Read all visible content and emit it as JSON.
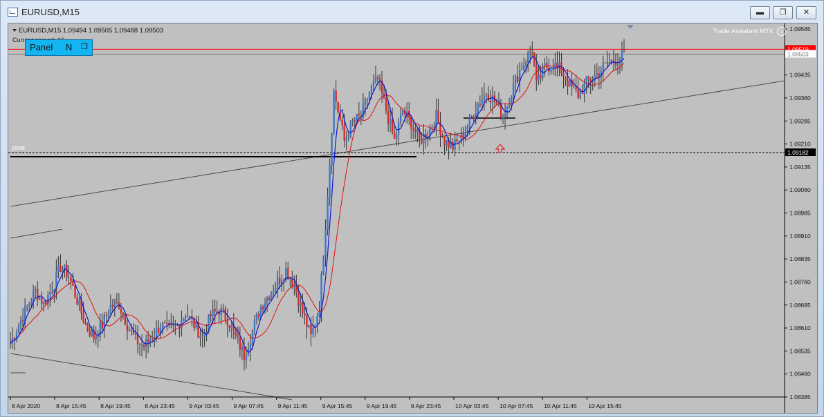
{
  "window": {
    "title": "EURUSD,M15",
    "minimize_glyph": "▬",
    "restore_glyph": "❐",
    "close_glyph": "✕"
  },
  "chart_header": {
    "info": "EURUSD,M15  1.09494 1.09505 1.09488 1.09503",
    "spread": "Current spread: 16",
    "indicator": "Trade Assistant MT4"
  },
  "panel": {
    "label": "Panel",
    "letter": "N",
    "icon": "restore-icon"
  },
  "colors": {
    "background": "#c0c0c0",
    "bull": "#3f77c4",
    "bear": "#d42b2b",
    "ma_fast": "#1414c8",
    "ma_slow": "#e01010",
    "resistance": "#ff0000",
    "arrow": "#e02020"
  },
  "chart_data": {
    "type": "candlestick",
    "symbol": "EURUSD",
    "timeframe": "M15",
    "last_ohlc": {
      "open": 1.09494,
      "high": 1.09505,
      "low": 1.09488,
      "close": 1.09503
    },
    "ylim": [
      1.08385,
      1.09585
    ],
    "y_ticks": [
      "1.09585",
      "1.09435",
      "1.09360",
      "1.09285",
      "1.09210",
      "1.09135",
      "1.09060",
      "1.08985",
      "1.08910",
      "1.08835",
      "1.08760",
      "1.08685",
      "1.08610",
      "1.08535",
      "1.08460",
      "1.08385"
    ],
    "x_ticks": [
      "8 Apr 2020",
      "8 Apr 15:45",
      "8 Apr 19:45",
      "8 Apr 23:45",
      "9 Apr 03:45",
      "9 Apr 07:45",
      "9 Apr 11:45",
      "9 Apr 15:45",
      "9 Apr 19:45",
      "9 Apr 23:45",
      "10 Apr 03:45",
      "10 Apr 07:45",
      "10 Apr 11:45",
      "10 Apr 15:45"
    ],
    "price_labels": [
      {
        "value": "1.09519",
        "kind": "resistance"
      },
      {
        "value": "1.09503",
        "kind": "current"
      },
      {
        "value": "1.09182",
        "kind": "pivot"
      }
    ],
    "pivot_label": "pivot",
    "close_path": [
      [
        0,
        1.0856
      ],
      [
        4,
        1.0862
      ],
      [
        8,
        1.0868
      ],
      [
        12,
        1.0873
      ],
      [
        16,
        1.0869
      ],
      [
        20,
        1.0874
      ],
      [
        24,
        1.0881
      ],
      [
        28,
        1.0878
      ],
      [
        32,
        1.087
      ],
      [
        36,
        1.0862
      ],
      [
        40,
        1.0858
      ],
      [
        44,
        1.0862
      ],
      [
        48,
        1.0868
      ],
      [
        52,
        1.0869
      ],
      [
        56,
        1.0862
      ],
      [
        60,
        1.0857
      ],
      [
        64,
        1.0855
      ],
      [
        68,
        1.0858
      ],
      [
        72,
        1.0862
      ],
      [
        76,
        1.086
      ],
      [
        80,
        1.0862
      ],
      [
        84,
        1.0866
      ],
      [
        88,
        1.0862
      ],
      [
        92,
        1.0858
      ],
      [
        96,
        1.0865
      ],
      [
        100,
        1.0867
      ],
      [
        104,
        1.0864
      ],
      [
        108,
        1.0858
      ],
      [
        112,
        1.0852
      ],
      [
        116,
        1.086
      ],
      [
        120,
        1.0868
      ],
      [
        124,
        1.0872
      ],
      [
        128,
        1.0876
      ],
      [
        132,
        1.088
      ],
      [
        136,
        1.0875
      ],
      [
        140,
        1.0866
      ],
      [
        144,
        1.0858
      ],
      [
        148,
        1.0868
      ],
      [
        151,
        1.0895
      ],
      [
        153,
        1.0915
      ],
      [
        155,
        1.0938
      ],
      [
        157,
        1.0932
      ],
      [
        160,
        1.0922
      ],
      [
        164,
        1.0928
      ],
      [
        168,
        1.093
      ],
      [
        172,
        1.0938
      ],
      [
        176,
        1.0942
      ],
      [
        180,
        1.0932
      ],
      [
        184,
        1.0922
      ],
      [
        188,
        1.0932
      ],
      [
        192,
        1.0928
      ],
      [
        196,
        1.0922
      ],
      [
        200,
        1.0925
      ],
      [
        204,
        1.093
      ],
      [
        208,
        1.0922
      ],
      [
        212,
        1.092
      ],
      [
        216,
        1.0923
      ],
      [
        220,
        1.0928
      ],
      [
        224,
        1.0934
      ],
      [
        228,
        1.0938
      ],
      [
        232,
        1.0935
      ],
      [
        236,
        1.093
      ],
      [
        240,
        1.0938
      ],
      [
        244,
        1.0945
      ],
      [
        248,
        1.095
      ],
      [
        250,
        1.0952
      ],
      [
        252,
        1.094
      ],
      [
        256,
        1.0946
      ],
      [
        260,
        1.0947
      ],
      [
        264,
        1.0945
      ],
      [
        268,
        1.094
      ],
      [
        272,
        1.0937
      ],
      [
        276,
        1.0941
      ],
      [
        280,
        1.0943
      ],
      [
        284,
        1.0946
      ],
      [
        288,
        1.0948
      ],
      [
        292,
        1.0949
      ],
      [
        294,
        1.095
      ]
    ]
  }
}
